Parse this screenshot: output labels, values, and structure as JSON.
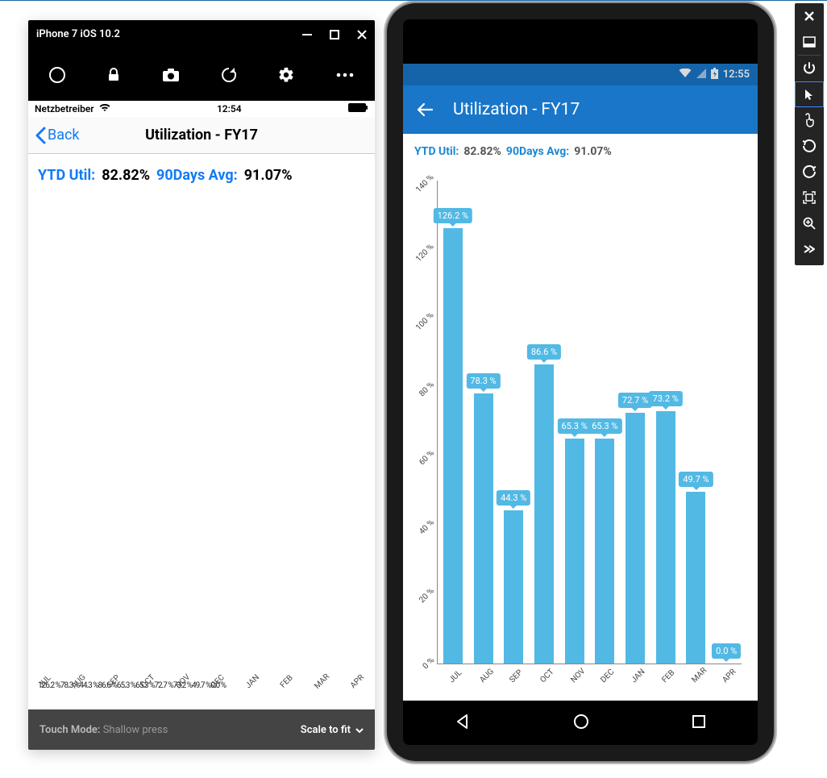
{
  "chart_data": {
    "type": "bar",
    "title": "Utilization - FY17",
    "categories": [
      "JUL",
      "AUG",
      "SEP",
      "OCT",
      "NOV",
      "DEC",
      "JAN",
      "FEB",
      "MAR",
      "APR"
    ],
    "values": [
      126.2,
      78.3,
      44.3,
      86.6,
      65.3,
      65.3,
      72.7,
      73.2,
      49.7,
      0.0
    ],
    "value_unit": "%",
    "ylim": [
      0,
      140
    ],
    "yticks": [
      0,
      20,
      40,
      60,
      80,
      100,
      120,
      140
    ],
    "ytick_labels": [
      "0 %",
      "20 %",
      "40 %",
      "60 %",
      "80 %",
      "100 %",
      "120 %",
      "140 %"
    ],
    "data_labels": [
      "126.2 %",
      "78.3 %",
      "44.3 %",
      "86.6 %",
      "65.3 %",
      "65.3 %",
      "72.7 %",
      "73.2 %",
      "49.7 %",
      "0.0 %"
    ]
  },
  "iphone": {
    "window_title": "iPhone 7 iOS 10.2",
    "status": {
      "carrier": "Netzbetreiber",
      "time": "12:54"
    },
    "nav": {
      "back_label": "Back",
      "title": "Utilization - FY17"
    },
    "summary": {
      "ytd_label": "YTD Util:",
      "ytd_value": "82.82%",
      "avg90_label": "90Days Avg:",
      "avg90_value": "91.07%"
    },
    "chart_xlabels": [
      "JUL",
      "AUG",
      "SEP",
      "OCT",
      "NOV",
      "DEC",
      "JAN",
      "FEB",
      "MAR",
      "APR"
    ],
    "chart_datalabels_row": "126.2 %78.3 %44.3 %86.6 %65.3 %65.3 %72.7 %73.2 %49.7 %0.0 %",
    "footer": {
      "touch_mode_label": "Touch Mode:",
      "touch_mode_value": "Shallow press",
      "scale_label": "Scale to fit"
    }
  },
  "android": {
    "status": {
      "time": "12:55"
    },
    "appbar": {
      "title": "Utilization - FY17"
    },
    "summary": {
      "ytd_label": "YTD Util:",
      "ytd_value": "82.82%",
      "avg90_label": "90Days Avg:",
      "avg90_value": "91.07%"
    }
  }
}
